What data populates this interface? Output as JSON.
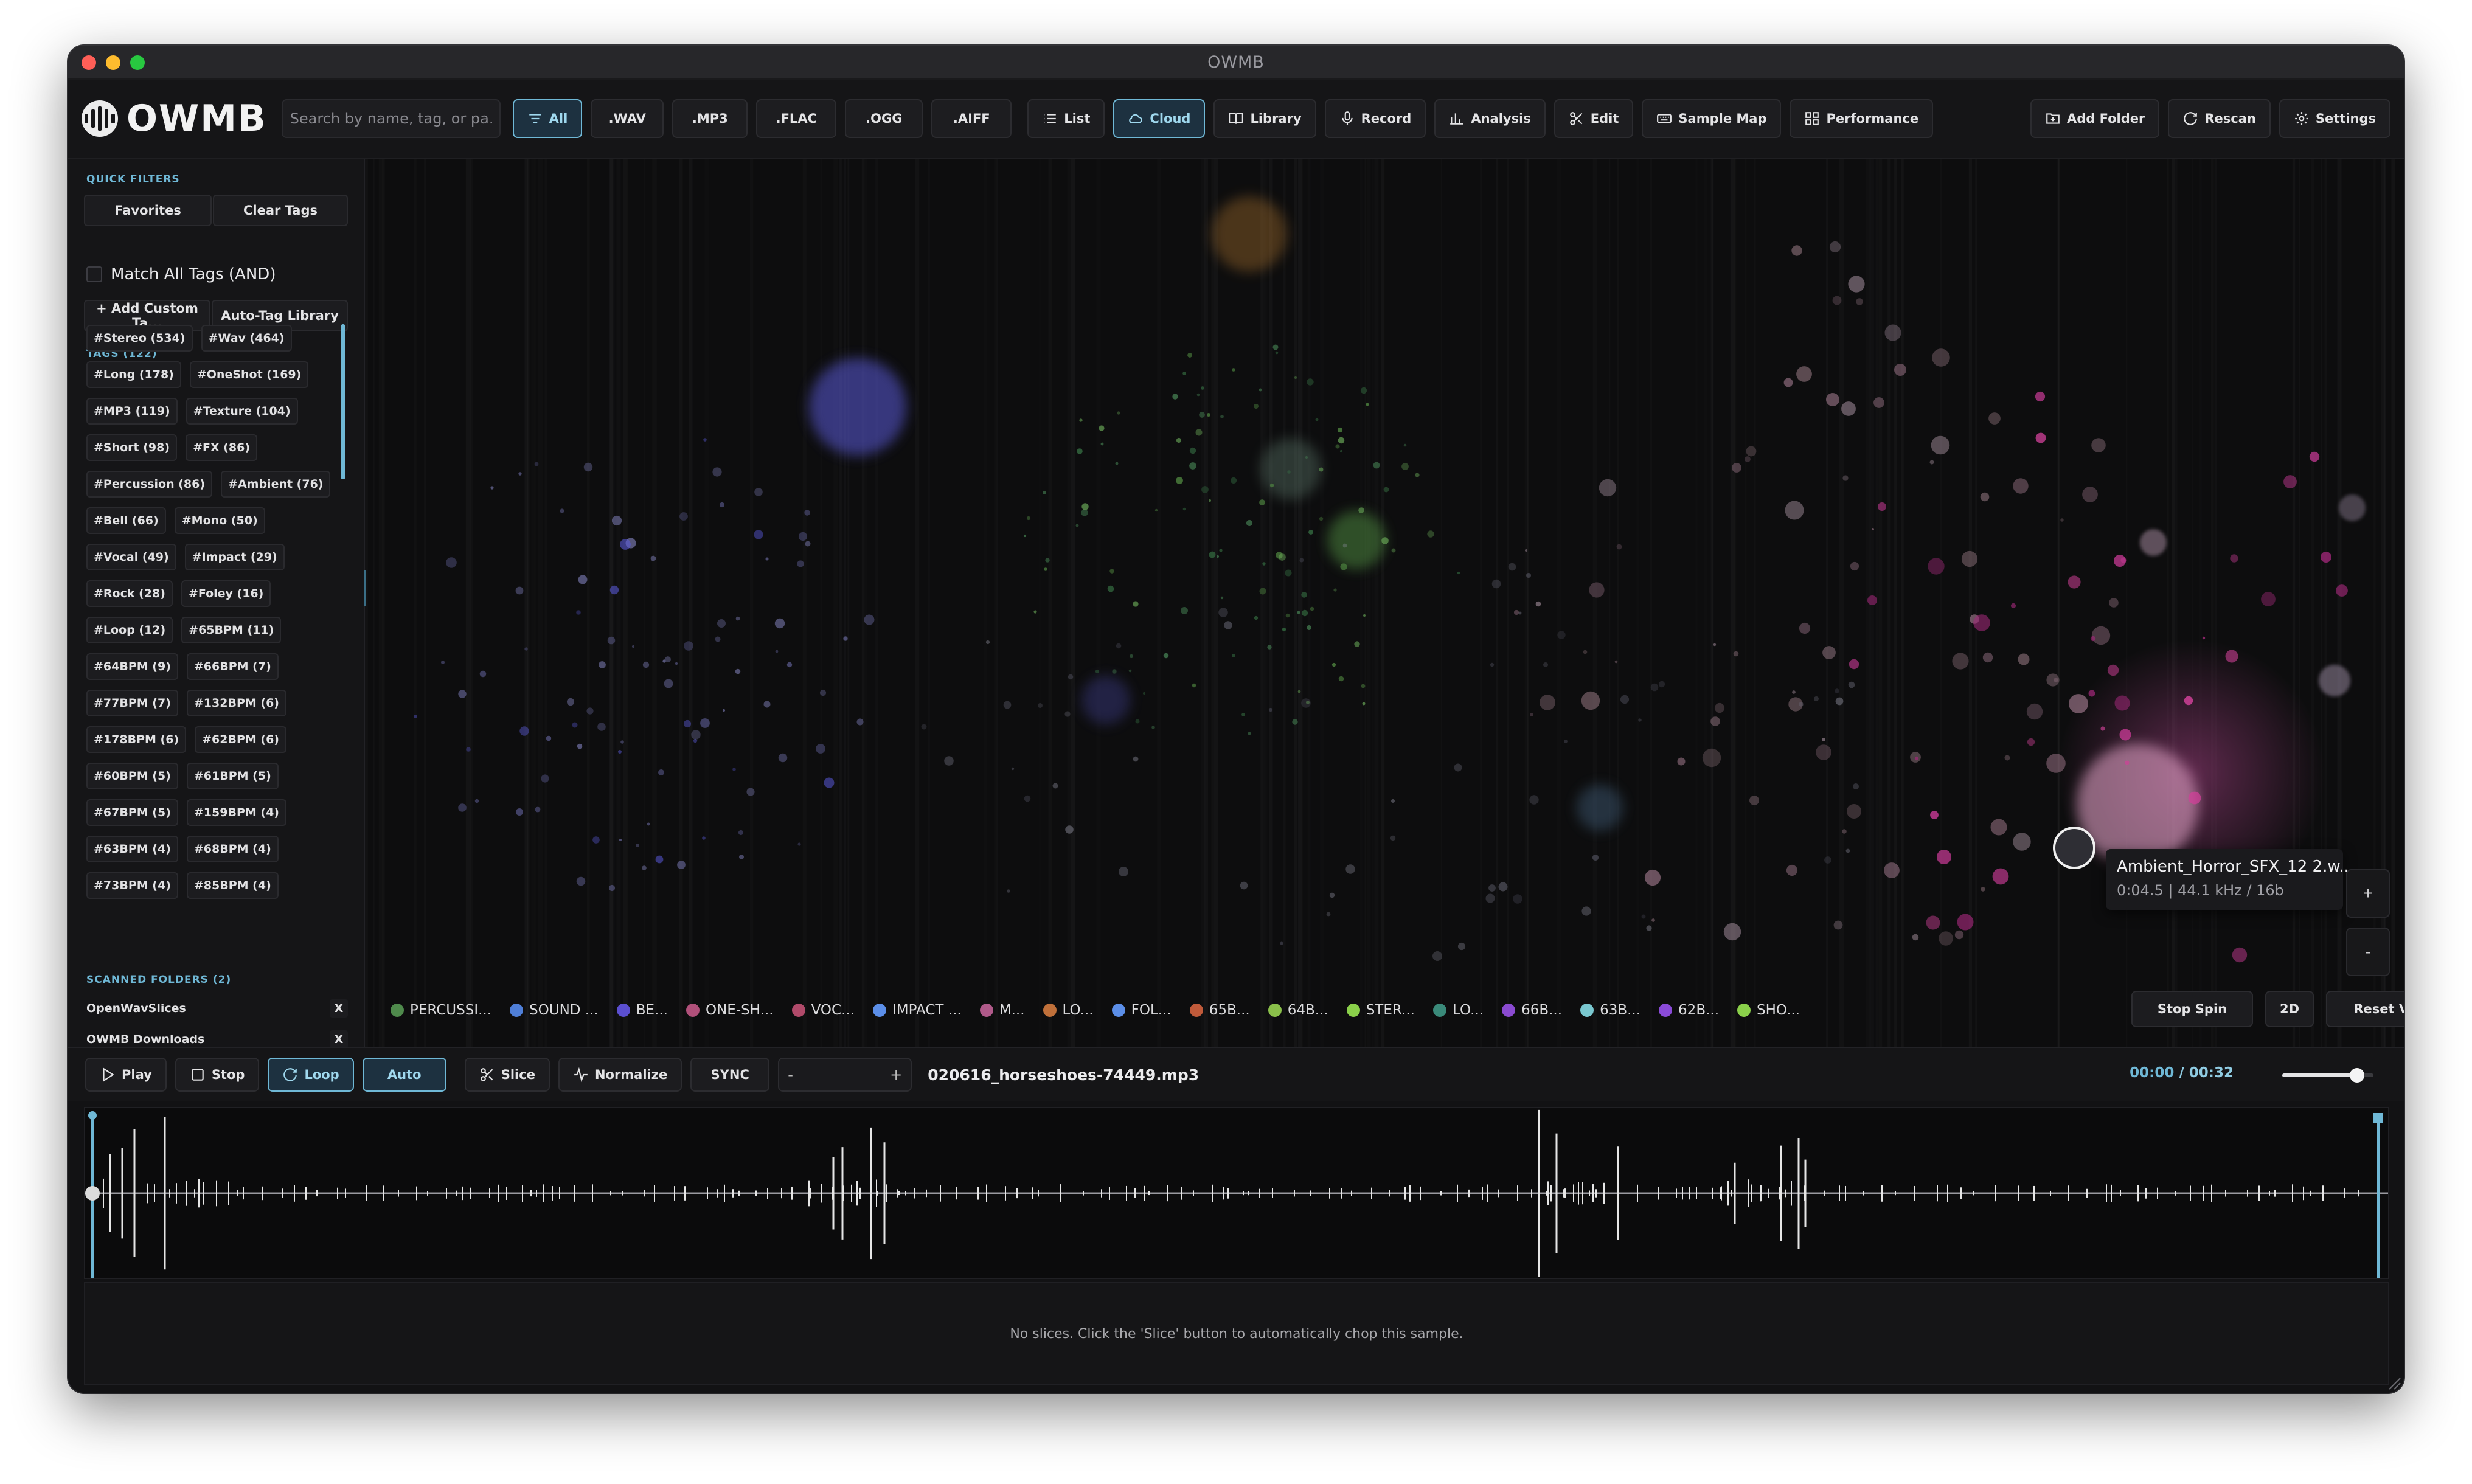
{
  "window": {
    "title": "OWMB"
  },
  "colors": {
    "accent": "#6fb8d6",
    "close": "#ff5f57",
    "minimize": "#febc2e",
    "maximize": "#28c840"
  },
  "toolbar": {
    "logo_text": "OWMB",
    "search_placeholder": "Search by name, tag, or pa...",
    "format_filters": [
      {
        "label": "All",
        "active": true,
        "icon": "filter-lines-icon"
      },
      {
        "label": ".WAV",
        "active": false
      },
      {
        "label": ".MP3",
        "active": false
      },
      {
        "label": ".FLAC",
        "active": false
      },
      {
        "label": ".OGG",
        "active": false
      },
      {
        "label": ".AIFF",
        "active": false
      }
    ],
    "views": [
      {
        "label": "List",
        "active": false,
        "icon": "list-icon"
      },
      {
        "label": "Cloud",
        "active": true,
        "icon": "cloud-icon"
      },
      {
        "label": "Library",
        "active": false,
        "icon": "book-icon"
      },
      {
        "label": "Record",
        "active": false,
        "icon": "microphone-icon"
      },
      {
        "label": "Analysis",
        "active": false,
        "icon": "bar-chart-icon"
      },
      {
        "label": "Edit",
        "active": false,
        "icon": "scissors-icon"
      },
      {
        "label": "Sample Map",
        "active": false,
        "icon": "keyboard-icon"
      },
      {
        "label": "Performance",
        "active": false,
        "icon": "grid-icon"
      }
    ],
    "right_buttons": [
      {
        "label": "Add Folder",
        "icon": "folder-plus-icon"
      },
      {
        "label": "Rescan",
        "icon": "refresh-icon"
      },
      {
        "label": "Settings",
        "icon": "gear-icon"
      }
    ]
  },
  "sidebar": {
    "quick_filters_label": "QUICK FILTERS",
    "favorites_label": "Favorites",
    "clear_tags_label": "Clear Tags",
    "match_all_label": "Match All Tags (AND)",
    "match_all_checked": false,
    "add_custom_tag_label": "+ Add Custom Ta...",
    "auto_tag_label": "Auto-Tag Library",
    "tags_label": "TAGS (122)",
    "tags": [
      [
        "#Stereo (534)",
        "#Wav (464)"
      ],
      [
        "#Long (178)",
        "#OneShot (169)"
      ],
      [
        "#MP3 (119)",
        "#Texture (104)"
      ],
      [
        "#Short (98)",
        "#FX (86)"
      ],
      [
        "#Percussion (86)",
        "#Ambient (76)"
      ],
      [
        "#Bell (66)",
        "#Mono (50)"
      ],
      [
        "#Vocal (49)",
        "#Impact (29)"
      ],
      [
        "#Rock (28)",
        "#Foley (16)"
      ],
      [
        "#Loop (12)",
        "#65BPM (11)"
      ],
      [
        "#64BPM (9)",
        "#66BPM (7)"
      ],
      [
        "#77BPM (7)",
        "#132BPM (6)"
      ],
      [
        "#178BPM (6)",
        "#62BPM (6)"
      ],
      [
        "#60BPM (5)",
        "#61BPM (5)"
      ],
      [
        "#67BPM (5)",
        "#159BPM (4)"
      ],
      [
        "#63BPM (4)",
        "#68BPM (4)"
      ],
      [
        "#73BPM (4)",
        "#85BPM (4)"
      ]
    ],
    "scanned_folders_label": "SCANNED FOLDERS (2)",
    "folders": [
      {
        "name": "OpenWavSlices",
        "remove": "X"
      },
      {
        "name": "OWMB Downloads",
        "remove": "X"
      }
    ]
  },
  "cloud": {
    "legend": [
      {
        "label": "PERCUSSI...",
        "color": "#4f8a4c"
      },
      {
        "label": "SOUND ...",
        "color": "#4f7fd8"
      },
      {
        "label": "BE...",
        "color": "#5b4fd0"
      },
      {
        "label": "ONE-SH...",
        "color": "#b0507a"
      },
      {
        "label": "VOC...",
        "color": "#b04a6a"
      },
      {
        "label": "IMPACT ...",
        "color": "#5b8ee8"
      },
      {
        "label": "M...",
        "color": "#b05a8a"
      },
      {
        "label": "LO...",
        "color": "#c0703a"
      },
      {
        "label": "FOL...",
        "color": "#5b8ee8"
      },
      {
        "label": "65B...",
        "color": "#c05a3a"
      },
      {
        "label": "64B...",
        "color": "#8ac04a"
      },
      {
        "label": "STER...",
        "color": "#8ad04a"
      },
      {
        "label": "LO...",
        "color": "#3a8a7a"
      },
      {
        "label": "66B...",
        "color": "#8a4ad0"
      },
      {
        "label": "63B...",
        "color": "#7ac8d0"
      },
      {
        "label": "62B...",
        "color": "#8a4ad8"
      },
      {
        "label": "SHO...",
        "color": "#8ad04a"
      }
    ],
    "stop_spin_label": "Stop Spin",
    "mode_label": "2D",
    "reset_view_label": "Reset View",
    "zoom_in_label": "+",
    "zoom_out_label": "-",
    "tooltip": {
      "name": "Ambient_Horror_SFX_12 2.w...",
      "info": "0:04.5 | 44.1 kHz / 16b"
    }
  },
  "transport": {
    "play_label": "Play",
    "stop_label": "Stop",
    "loop_label": "Loop",
    "loop_active": true,
    "auto_label": "Auto",
    "auto_active": true,
    "slice_label": "Slice",
    "normalize_label": "Normalize",
    "sync_label": "SYNC",
    "bpm_minus": "-",
    "bpm_plus": "+",
    "bpm_value": "",
    "filename": "020616_horseshoes-74449.mp3",
    "current_time": "00:00",
    "time_sep": "/",
    "duration": "00:32",
    "volume": 0.82
  },
  "slices": {
    "empty_message": "No slices. Click the 'Slice' button to automatically chop this sample."
  }
}
